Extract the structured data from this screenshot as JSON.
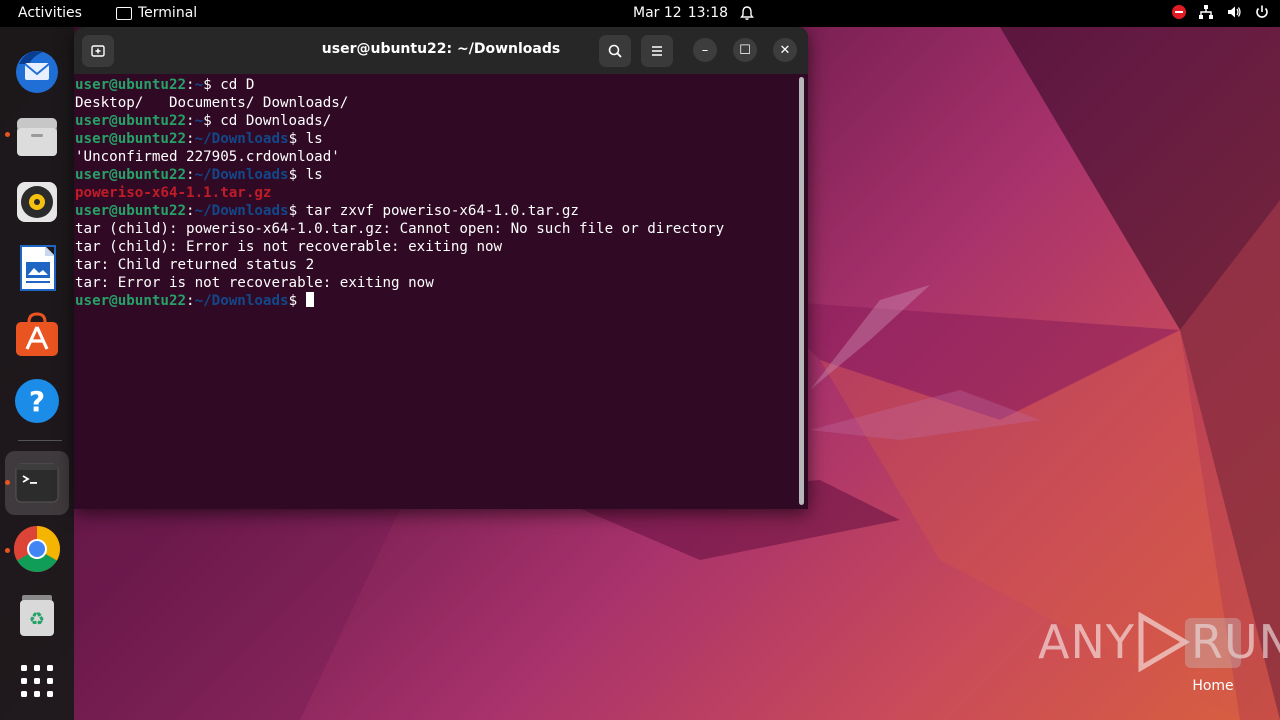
{
  "topbar": {
    "activities": "Activities",
    "app_name": "Terminal",
    "date": "Mar 12",
    "time": "13:18",
    "icons": [
      "notification-bell-icon",
      "recording-icon",
      "network-icon",
      "volume-icon",
      "power-icon"
    ]
  },
  "dock": {
    "items": [
      "thunderbird-icon",
      "files-icon",
      "rhythmbox-icon",
      "libreoffice-writer-icon",
      "app-center-icon",
      "help-icon",
      "terminal-icon",
      "chrome-icon",
      "trash-icon",
      "show-apps-icon"
    ]
  },
  "window": {
    "title": "user@ubuntu22: ~/Downloads",
    "new_tab_icon": "new-tab-icon",
    "search_icon": "search-icon",
    "menu_icon": "hamburger-menu-icon",
    "minimize": "–",
    "maximize": "☐",
    "close": "✕"
  },
  "terminal": {
    "user": "user@ubuntu22",
    "lines": [
      {
        "type": "prompt",
        "path": "~",
        "cmd": "$ cd D"
      },
      {
        "type": "out",
        "text": "Desktop/   Documents/ Downloads/"
      },
      {
        "type": "prompt",
        "path": "~",
        "cmd": "$ cd Downloads/"
      },
      {
        "type": "prompt",
        "path": "~/Downloads",
        "cmd": "$ ls"
      },
      {
        "type": "out",
        "text": "'Unconfirmed 227905.crdownload'"
      },
      {
        "type": "prompt",
        "path": "~/Downloads",
        "cmd": "$ ls"
      },
      {
        "type": "red",
        "text": "poweriso-x64-1.1.tar.gz"
      },
      {
        "type": "prompt",
        "path": "~/Downloads",
        "cmd": "$ tar zxvf poweriso-x64-1.0.tar.gz"
      },
      {
        "type": "out",
        "text": "tar (child): poweriso-x64-1.0.tar.gz: Cannot open: No such file or directory"
      },
      {
        "type": "out",
        "text": "tar (child): Error is not recoverable: exiting now"
      },
      {
        "type": "out",
        "text": "tar: Child returned status 2"
      },
      {
        "type": "out",
        "text": "tar: Error is not recoverable: exiting now"
      },
      {
        "type": "prompt",
        "path": "~/Downloads",
        "cmd": "$ ",
        "cursor": true
      }
    ]
  },
  "desktop": {
    "watermark_left": "ANY",
    "watermark_right": "RUN",
    "home_label": "Home"
  }
}
